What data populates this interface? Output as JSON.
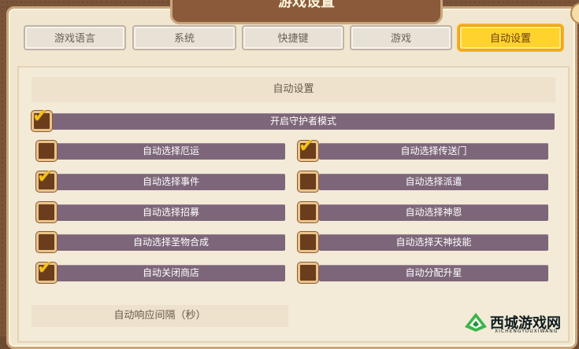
{
  "window": {
    "title": "游戏设置"
  },
  "tabs": [
    {
      "label": "游戏语言",
      "active": false
    },
    {
      "label": "系统",
      "active": false
    },
    {
      "label": "快捷键",
      "active": false
    },
    {
      "label": "游戏",
      "active": false
    },
    {
      "label": "自动设置",
      "active": true
    }
  ],
  "section": {
    "title": "自动设置"
  },
  "master_option": {
    "label": "开启守护者模式",
    "checked": true
  },
  "left_options": [
    {
      "label": "自动选择厄运",
      "checked": false
    },
    {
      "label": "自动选择事件",
      "checked": true
    },
    {
      "label": "自动选择招募",
      "checked": false
    },
    {
      "label": "自动选择圣物合成",
      "checked": false
    },
    {
      "label": "自动关闭商店",
      "checked": true
    }
  ],
  "right_options": [
    {
      "label": "自动选择传送门",
      "checked": true
    },
    {
      "label": "自动选择派遣",
      "checked": false
    },
    {
      "label": "自动选择神恩",
      "checked": false
    },
    {
      "label": "自动选择天神技能",
      "checked": false
    },
    {
      "label": "自动分配升星",
      "checked": false
    }
  ],
  "footer": {
    "interval_label": "自动响应间隔（秒）"
  },
  "watermark": {
    "brand": "西城游戏网",
    "sub": "XICHENGYOUXIWANG"
  },
  "colors": {
    "active_tab": "#ffd22e",
    "option_bar": "#7d6679",
    "checkmark": "#f4c21a"
  }
}
